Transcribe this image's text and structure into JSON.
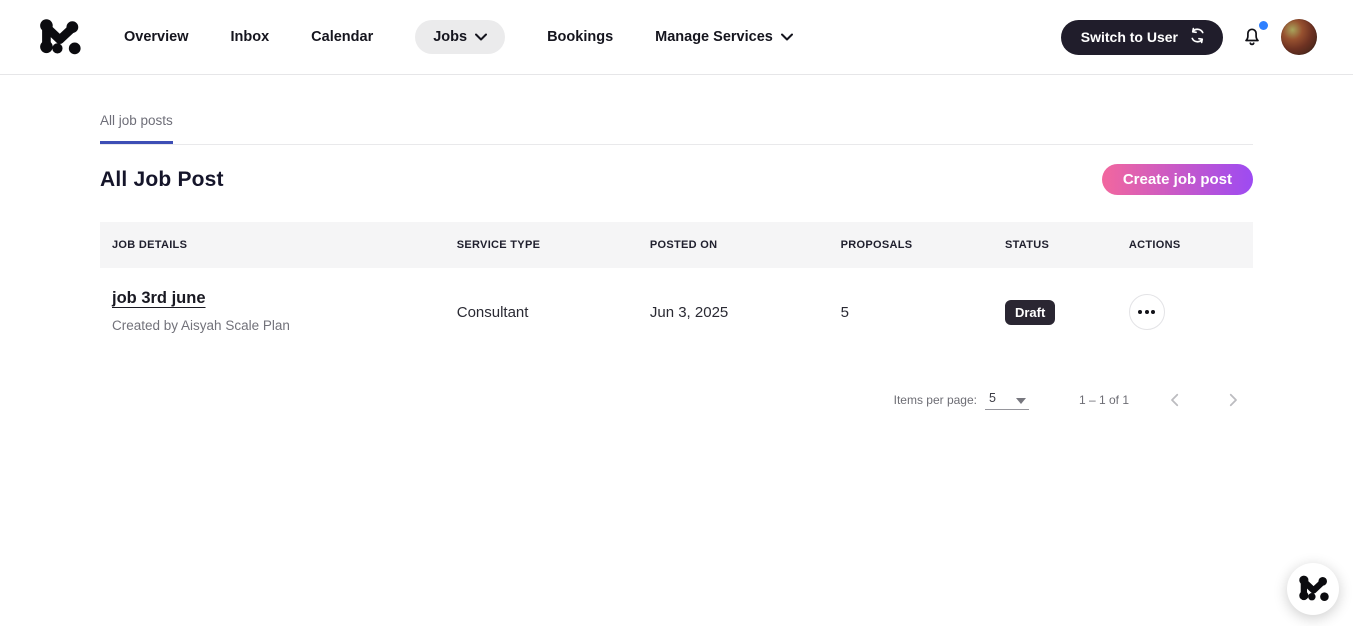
{
  "nav": {
    "overview": "Overview",
    "inbox": "Inbox",
    "calendar": "Calendar",
    "jobs": "Jobs",
    "bookings": "Bookings",
    "manage_services": "Manage Services",
    "switch_to_user": "Switch to User"
  },
  "tabs": {
    "all_job_posts": "All job posts"
  },
  "page": {
    "title": "All Job Post",
    "create_button": "Create job post"
  },
  "table": {
    "headers": {
      "job_details": "JOB DETAILS",
      "service_type": "SERVICE TYPE",
      "posted_on": "POSTED ON",
      "proposals": "PROPOSALS",
      "status": "STATUS",
      "actions": "ACTIONS"
    },
    "rows": [
      {
        "job_title": "job 3rd june",
        "created_by": "Created by Aisyah Scale Plan",
        "service_type": "Consultant",
        "posted_on": "Jun 3, 2025",
        "proposals": "5",
        "status": "Draft"
      }
    ]
  },
  "pagination": {
    "items_per_page_label": "Items per page:",
    "items_per_page_value": "5",
    "range_label": "1 – 1 of 1"
  },
  "icons": {
    "logo": "m-molecule-logo",
    "chevron_down": "chevron-down-icon",
    "sync": "sync-icon",
    "bell": "bell-icon",
    "ellipsis": "ellipsis-icon",
    "caret": "caret-down-icon",
    "chevron_left": "chevron-left-icon",
    "chevron_right": "chevron-right-icon"
  },
  "colors": {
    "accent_start": "#f2679e",
    "accent_end": "#9d4bf2",
    "tab_underline": "#3d4eb5",
    "dark_button": "#201d2b",
    "badge_bg": "#2a2632",
    "notification_dot": "#2f80ff"
  }
}
